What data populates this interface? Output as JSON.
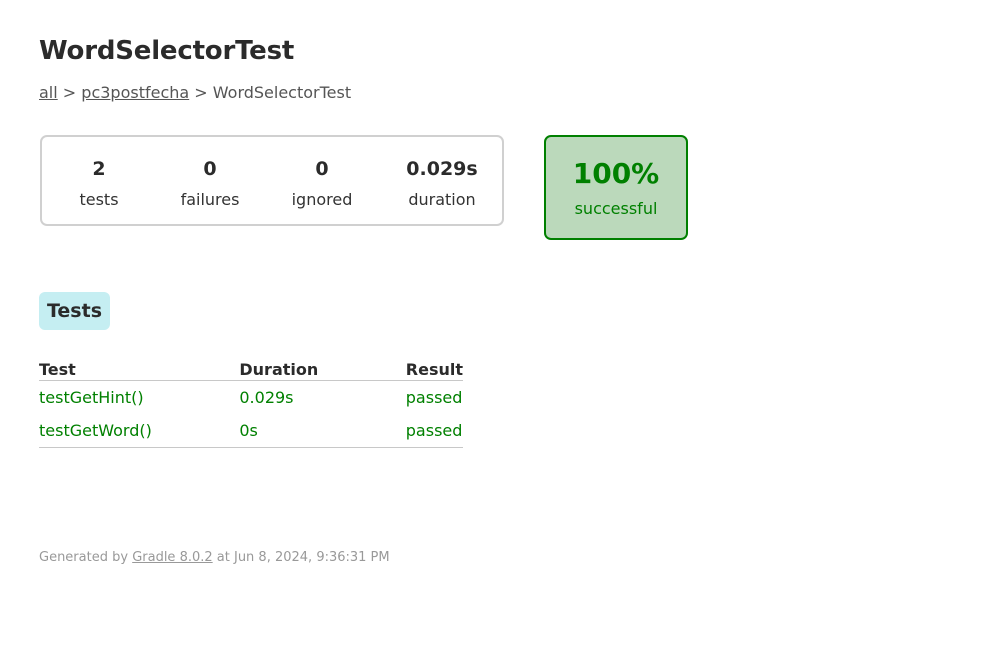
{
  "title": "WordSelectorTest",
  "breadcrumb": {
    "root_link": "all",
    "sep1": " > ",
    "package_link": "pc3postfecha",
    "sep2": " > ",
    "current": "WordSelectorTest"
  },
  "summary": {
    "tests": {
      "value": "2",
      "label": "tests"
    },
    "failures": {
      "value": "0",
      "label": "failures"
    },
    "ignored": {
      "value": "0",
      "label": "ignored"
    },
    "duration": {
      "value": "0.029s",
      "label": "duration"
    }
  },
  "success_rate": {
    "value": "100%",
    "label": "successful",
    "color": "#008000",
    "background": "#bbd9bb"
  },
  "tabs": [
    {
      "label": "Tests"
    }
  ],
  "table": {
    "headers": [
      "Test",
      "Duration",
      "Result"
    ],
    "rows": [
      {
        "test": "testGetHint()",
        "duration": "0.029s",
        "result": "passed"
      },
      {
        "test": "testGetWord()",
        "duration": "0s",
        "result": "passed"
      }
    ]
  },
  "footer": {
    "prefix": "Generated by ",
    "link": "Gradle 8.0.2",
    "suffix": " at Jun 8, 2024, 9:36:31 PM"
  }
}
